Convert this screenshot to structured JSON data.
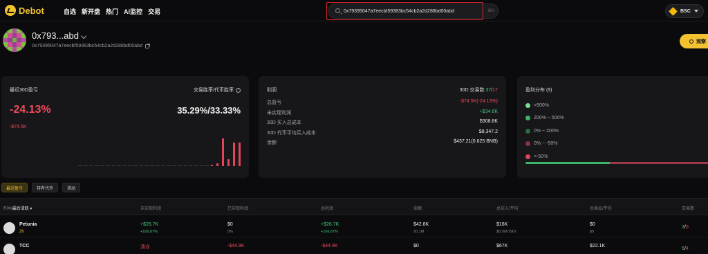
{
  "app": {
    "name": "Debot"
  },
  "nav": {
    "links": [
      "自选",
      "新开盘",
      "热门",
      "AI监控",
      "交易"
    ]
  },
  "search": {
    "value": "0x79395047a7eecbf59363bc54cb2a2d288bd00abd",
    "kbd": "⌘K"
  },
  "chain": {
    "label": "BSC"
  },
  "profile": {
    "short_name": "0x793...abd",
    "address": "0x79395047a7eecbf59363bc54cb2a2d288bd00abd",
    "watch_label": "观察"
  },
  "pnl_card": {
    "title": "最近30D盈亏",
    "winrate_title": "交易胜率/代币胜率",
    "pnl_pct": "-24.13%",
    "pnl_amount": "-$74.5K",
    "winrate": "35.29%/33.33%",
    "bars": [
      0,
      0,
      0,
      0,
      0,
      0,
      0,
      0,
      0,
      0,
      0,
      0,
      0,
      0,
      0,
      0,
      0,
      0,
      0,
      0,
      0,
      0,
      0,
      0,
      0.05,
      0.1,
      1.0,
      0.25,
      0.85,
      0.85
    ],
    "bar_colors": {
      "flat": "#3a3a40",
      "loss": "#e0455a"
    }
  },
  "profit_card": {
    "title": "利润",
    "trades_label": "30D 交易数",
    "trades_win": "37",
    "trades_loss": "17",
    "rows": [
      {
        "label": "总盈亏",
        "value": "-$74.5K(-24.13%)",
        "tone": "neg"
      },
      {
        "label": "未实现利润",
        "value": "+$34.6K",
        "tone": "pos"
      },
      {
        "label": "30D 买入总成本",
        "value": "$308.8K",
        "tone": ""
      },
      {
        "label": "30D 代币平均买入成本",
        "value": "$8,347.2",
        "tone": ""
      },
      {
        "label": "余额",
        "value": "$437.21(0.625 BNB)",
        "tone": ""
      }
    ]
  },
  "dist_card": {
    "title": "盈利分布 (9)",
    "rows": [
      {
        "label": ">500%",
        "color": "#7ddc8a"
      },
      {
        "label": "200% ~ 500%",
        "color": "#3eb36a"
      },
      {
        "label": "0% ~ 200%",
        "color": "#2d6b45"
      },
      {
        "label": "0% ~ -50%",
        "color": "#8a3340"
      },
      {
        "label": "<-50%",
        "color": "#e0455a"
      }
    ],
    "bar": [
      {
        "frac": 0.45,
        "color": "#3eb36a"
      },
      {
        "frac": 0.55,
        "color": "#9a3a48"
      }
    ]
  },
  "tabs": [
    {
      "label": "最近盈亏",
      "active": true
    },
    {
      "label": "持有代币",
      "active": false
    },
    {
      "label": "活动",
      "active": false
    }
  ],
  "table": {
    "headers": [
      "币种/最后活跃",
      "未实现利润",
      "已实现利润",
      "总利润",
      "余额",
      "总买入/平均",
      "总卖出/平均",
      "交易数"
    ],
    "rows": [
      {
        "name": "Petunia",
        "age": "2h",
        "unrealized": "+$26.7K",
        "unrealized_sub": "+166.87%",
        "realized": "$0",
        "realized_sub": "0%",
        "total": "+$26.7K",
        "total_sub": "+166.87%",
        "balance": "$42.8K",
        "balance_sub": "20.1M",
        "buy": "$16K",
        "buy_sub": "$0.0007967",
        "sell": "$0",
        "sell_sub": "$0",
        "trades_win": "3",
        "trades_loss": "0"
      },
      {
        "name": "TCC",
        "age": "",
        "unrealized": "清仓",
        "unrealized_sub": "",
        "realized": "-$44.9K",
        "realized_sub": "",
        "total": "-$44.9K",
        "total_sub": "",
        "balance": "$0",
        "balance_sub": "",
        "buy": "$67K",
        "buy_sub": "",
        "sell": "$22.1K",
        "sell_sub": "",
        "trades_win": "5",
        "trades_loss": "4"
      }
    ]
  }
}
